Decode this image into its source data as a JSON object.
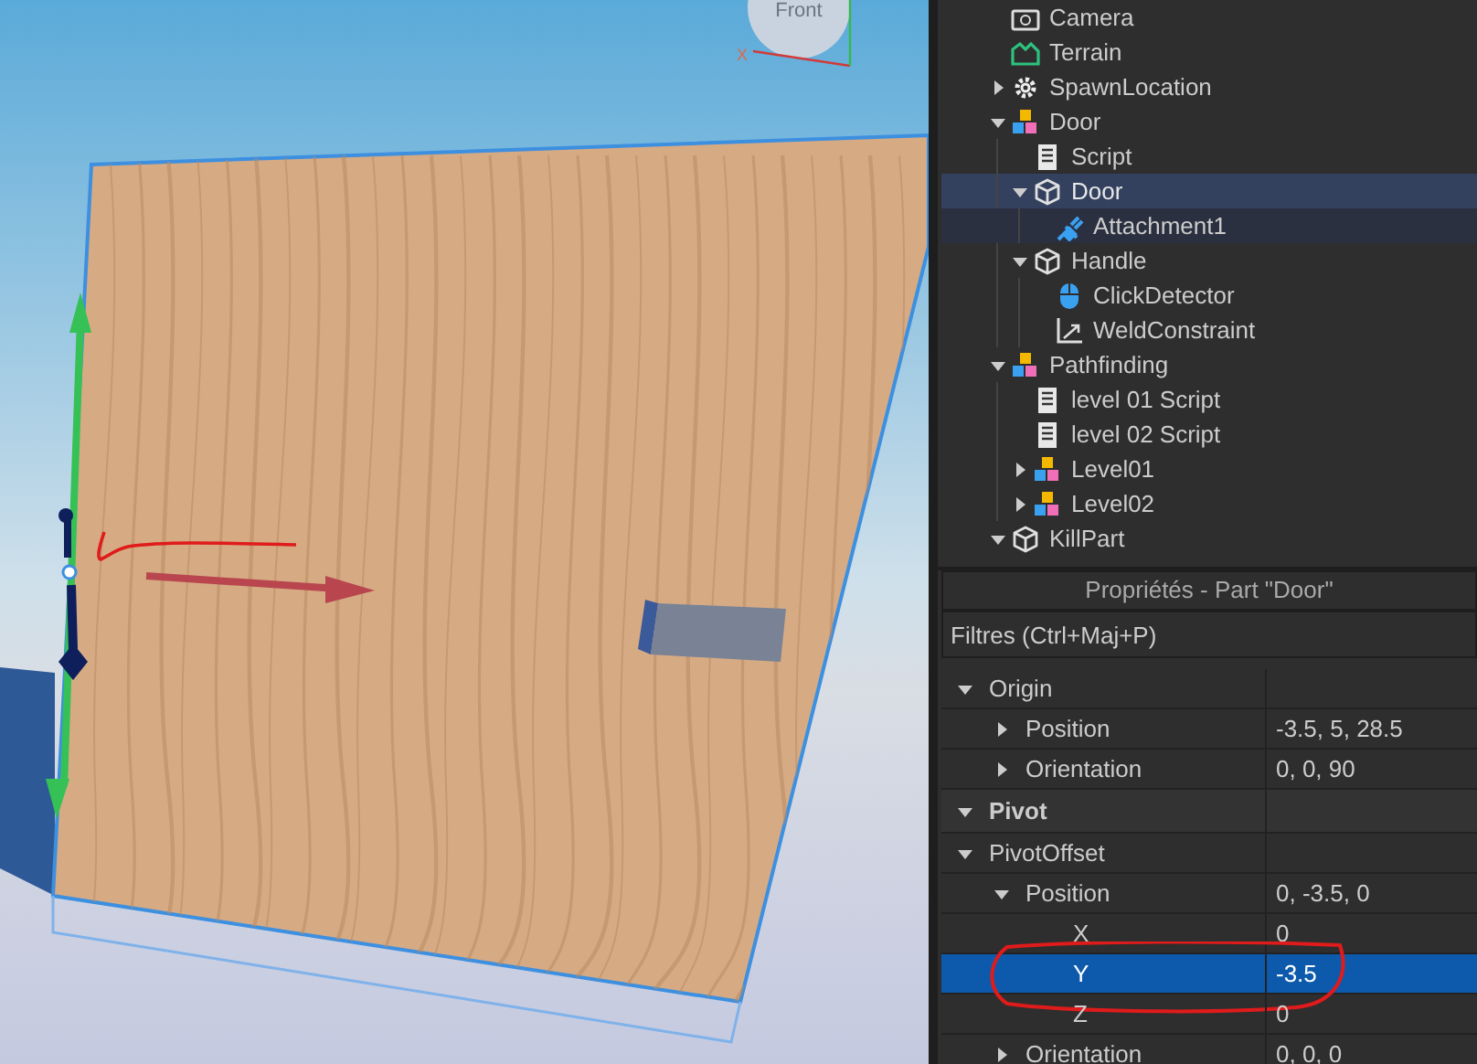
{
  "viewport": {
    "view_cube_label": "Front",
    "axis_label": "X"
  },
  "explorer": {
    "items": [
      {
        "name": "Camera",
        "kind": "camera"
      },
      {
        "name": "Terrain",
        "kind": "terrain"
      },
      {
        "name": "SpawnLocation",
        "kind": "spawn",
        "expanded": false
      },
      {
        "name": "Door",
        "kind": "model",
        "expanded": true,
        "children": [
          {
            "name": "Script",
            "kind": "script"
          },
          {
            "name": "Door",
            "kind": "part",
            "expanded": true,
            "selected": true,
            "children": [
              {
                "name": "Attachment1",
                "kind": "attachment",
                "selected": false,
                "hovered": true
              }
            ]
          },
          {
            "name": "Handle",
            "kind": "part",
            "expanded": true,
            "children": [
              {
                "name": "ClickDetector",
                "kind": "clickdetector"
              },
              {
                "name": "WeldConstraint",
                "kind": "weld"
              }
            ]
          }
        ]
      },
      {
        "name": "Pathfinding",
        "kind": "model",
        "expanded": true,
        "children": [
          {
            "name": "level 01 Script",
            "kind": "script"
          },
          {
            "name": "level 02 Script",
            "kind": "script"
          },
          {
            "name": "Level01",
            "kind": "model",
            "expanded": false
          },
          {
            "name": "Level02",
            "kind": "model",
            "expanded": false
          }
        ]
      },
      {
        "name": "KillPart",
        "kind": "part",
        "expanded": true
      }
    ]
  },
  "properties": {
    "title": "Propriétés - Part \"Door\"",
    "filter_placeholder": "Filtres (Ctrl+Maj+P)",
    "rows": [
      {
        "name": "Origin",
        "kind": "group",
        "expanded": true,
        "children": [
          {
            "name": "Position",
            "kind": "property",
            "expanded": false,
            "value": "-3.5, 5, 28.5"
          },
          {
            "name": "Orientation",
            "kind": "property",
            "expanded": false,
            "value": "0, 0, 90"
          }
        ]
      },
      {
        "name": "Pivot",
        "kind": "section",
        "expanded": true,
        "children": [
          {
            "name": "PivotOffset",
            "kind": "group",
            "expanded": true,
            "children": [
              {
                "name": "Position",
                "kind": "property",
                "expanded": true,
                "value": "0, -3.5, 0",
                "children": [
                  {
                    "name": "X",
                    "kind": "property",
                    "value": "0",
                    "selected": false
                  },
                  {
                    "name": "Y",
                    "kind": "property",
                    "value": "-3.5",
                    "selected": true
                  },
                  {
                    "name": "Z",
                    "kind": "property",
                    "value": "0",
                    "selected": false
                  }
                ]
              },
              {
                "name": "Orientation",
                "kind": "property",
                "expanded": false,
                "value": "0, 0, 0"
              }
            ]
          }
        ]
      }
    ]
  }
}
